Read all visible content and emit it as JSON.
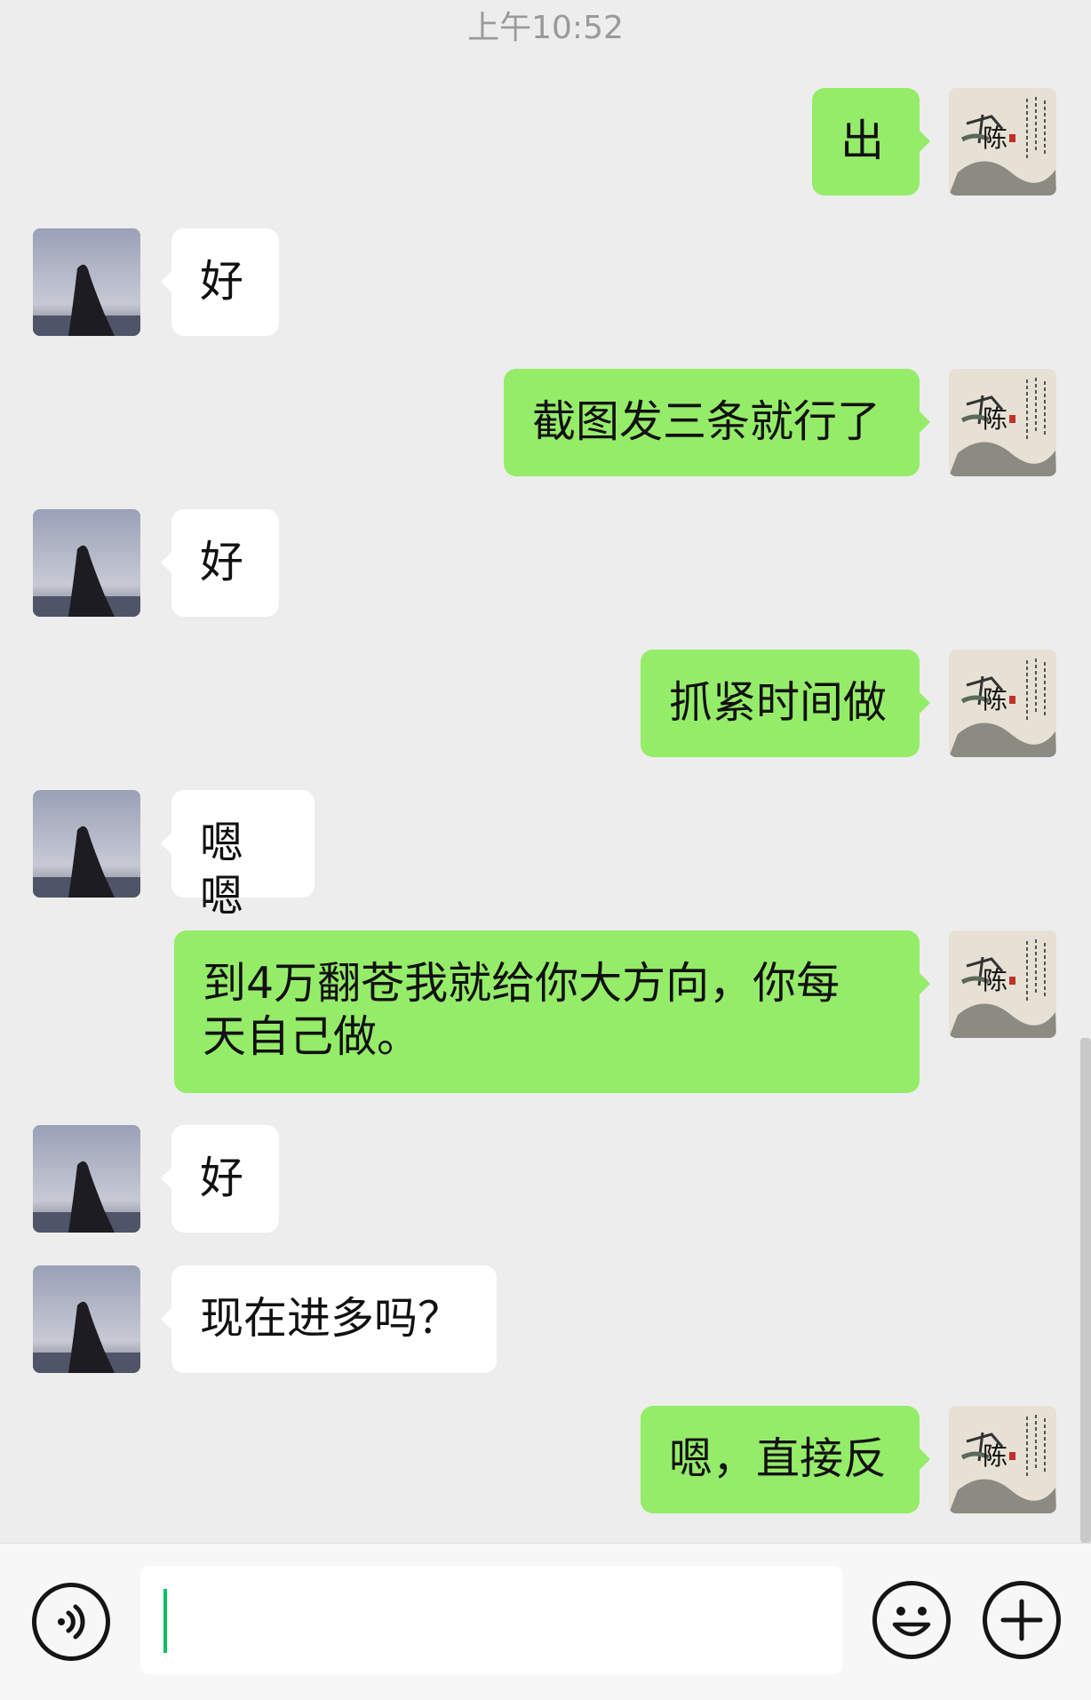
{
  "timestamp": "上午10:52",
  "messages": [
    {
      "side": "out",
      "text": "出"
    },
    {
      "side": "in",
      "text": "好"
    },
    {
      "side": "out",
      "text": "截图发三条就行了"
    },
    {
      "side": "in",
      "text": "好"
    },
    {
      "side": "out",
      "text": "抓紧时间做"
    },
    {
      "side": "in",
      "text": "嗯嗯"
    },
    {
      "side": "out",
      "text": "到4万翻苍我就给你大方向，你每天自己做。"
    },
    {
      "side": "in",
      "text": "好"
    },
    {
      "side": "in",
      "text": "现在进多吗？"
    },
    {
      "side": "out",
      "text": "嗯，直接反"
    }
  ],
  "avatars": {
    "self_seal_char": "陈"
  },
  "input": {
    "voice_icon": "voice-icon",
    "emoji_icon": "emoji-icon",
    "plus_icon": "plus-icon",
    "value": ""
  },
  "colors": {
    "background": "#ededed",
    "outgoing_bubble": "#95ec69",
    "incoming_bubble": "#ffffff",
    "caret": "#07c160"
  }
}
